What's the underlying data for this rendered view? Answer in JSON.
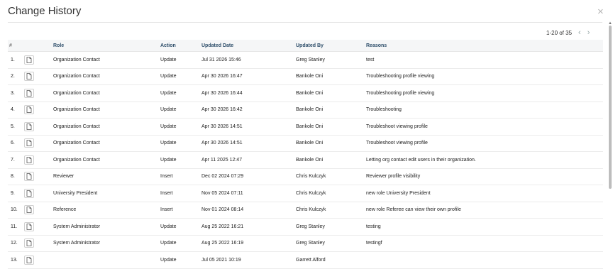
{
  "dialog": {
    "title": "Change History",
    "close_label": "×"
  },
  "pagination": {
    "range": "1-20 of 35",
    "prev_label": "‹",
    "next_label": "›"
  },
  "table": {
    "headers": {
      "num": "#",
      "role": "Role",
      "action": "Action",
      "date": "Updated Date",
      "by": "Updated By",
      "reasons": "Reasons"
    },
    "rows": [
      {
        "num": "1.",
        "role": "Organization Contact",
        "action": "Update",
        "date": "Jul 31 2026 15:46",
        "by": "Greg Stanley",
        "reason": "test"
      },
      {
        "num": "2.",
        "role": "Organization Contact",
        "action": "Update",
        "date": "Apr 30 2026 16:47",
        "by": "Bankole Oni",
        "reason": "Troubleshooting profile viewing"
      },
      {
        "num": "3.",
        "role": "Organization Contact",
        "action": "Update",
        "date": "Apr 30 2026 16:44",
        "by": "Bankole Oni",
        "reason": "Troubleshooting profile viewing"
      },
      {
        "num": "4.",
        "role": "Organization Contact",
        "action": "Update",
        "date": "Apr 30 2026 16:42",
        "by": "Bankole Oni",
        "reason": "Troubleshooting"
      },
      {
        "num": "5.",
        "role": "Organization Contact",
        "action": "Update",
        "date": "Apr 30 2026 14:51",
        "by": "Bankole Oni",
        "reason": "Troubleshoot viewing profile"
      },
      {
        "num": "6.",
        "role": "Organization Contact",
        "action": "Update",
        "date": "Apr 30 2026 14:51",
        "by": "Bankole Oni",
        "reason": "Troubleshoot viewing profile"
      },
      {
        "num": "7.",
        "role": "Organization Contact",
        "action": "Update",
        "date": "Apr 11 2025 12:47",
        "by": "Bankole Oni",
        "reason": "Letting org contact edit users in their organization."
      },
      {
        "num": "8.",
        "role": "Reviewer",
        "action": "Insert",
        "date": "Dec 02 2024 07:29",
        "by": "Chris Kulczyk",
        "reason": "Reviewer profile visibility"
      },
      {
        "num": "9.",
        "role": "University President",
        "action": "Insert",
        "date": "Nov 05 2024 07:11",
        "by": "Chris Kulczyk",
        "reason": "new role University President"
      },
      {
        "num": "10.",
        "role": "Reference",
        "action": "Insert",
        "date": "Nov 01 2024 08:14",
        "by": "Chris Kulczyk",
        "reason": "new role Referee can view their own profile"
      },
      {
        "num": "11.",
        "role": "System Administrator",
        "action": "Update",
        "date": "Aug 25 2022 16:21",
        "by": "Greg Stanley",
        "reason": "testing"
      },
      {
        "num": "12.",
        "role": "System Administrator",
        "action": "Update",
        "date": "Aug 25 2022 16:19",
        "by": "Greg Stanley",
        "reason": "testingf"
      },
      {
        "num": "13.",
        "role": "",
        "action": "Update",
        "date": "Jul 05 2021 10:19",
        "by": "Garrett Alford",
        "reason": ""
      }
    ]
  },
  "icons": {
    "row_icon": "document-icon",
    "close": "close-icon",
    "prev": "chevron-left-icon",
    "next": "chevron-right-icon"
  }
}
